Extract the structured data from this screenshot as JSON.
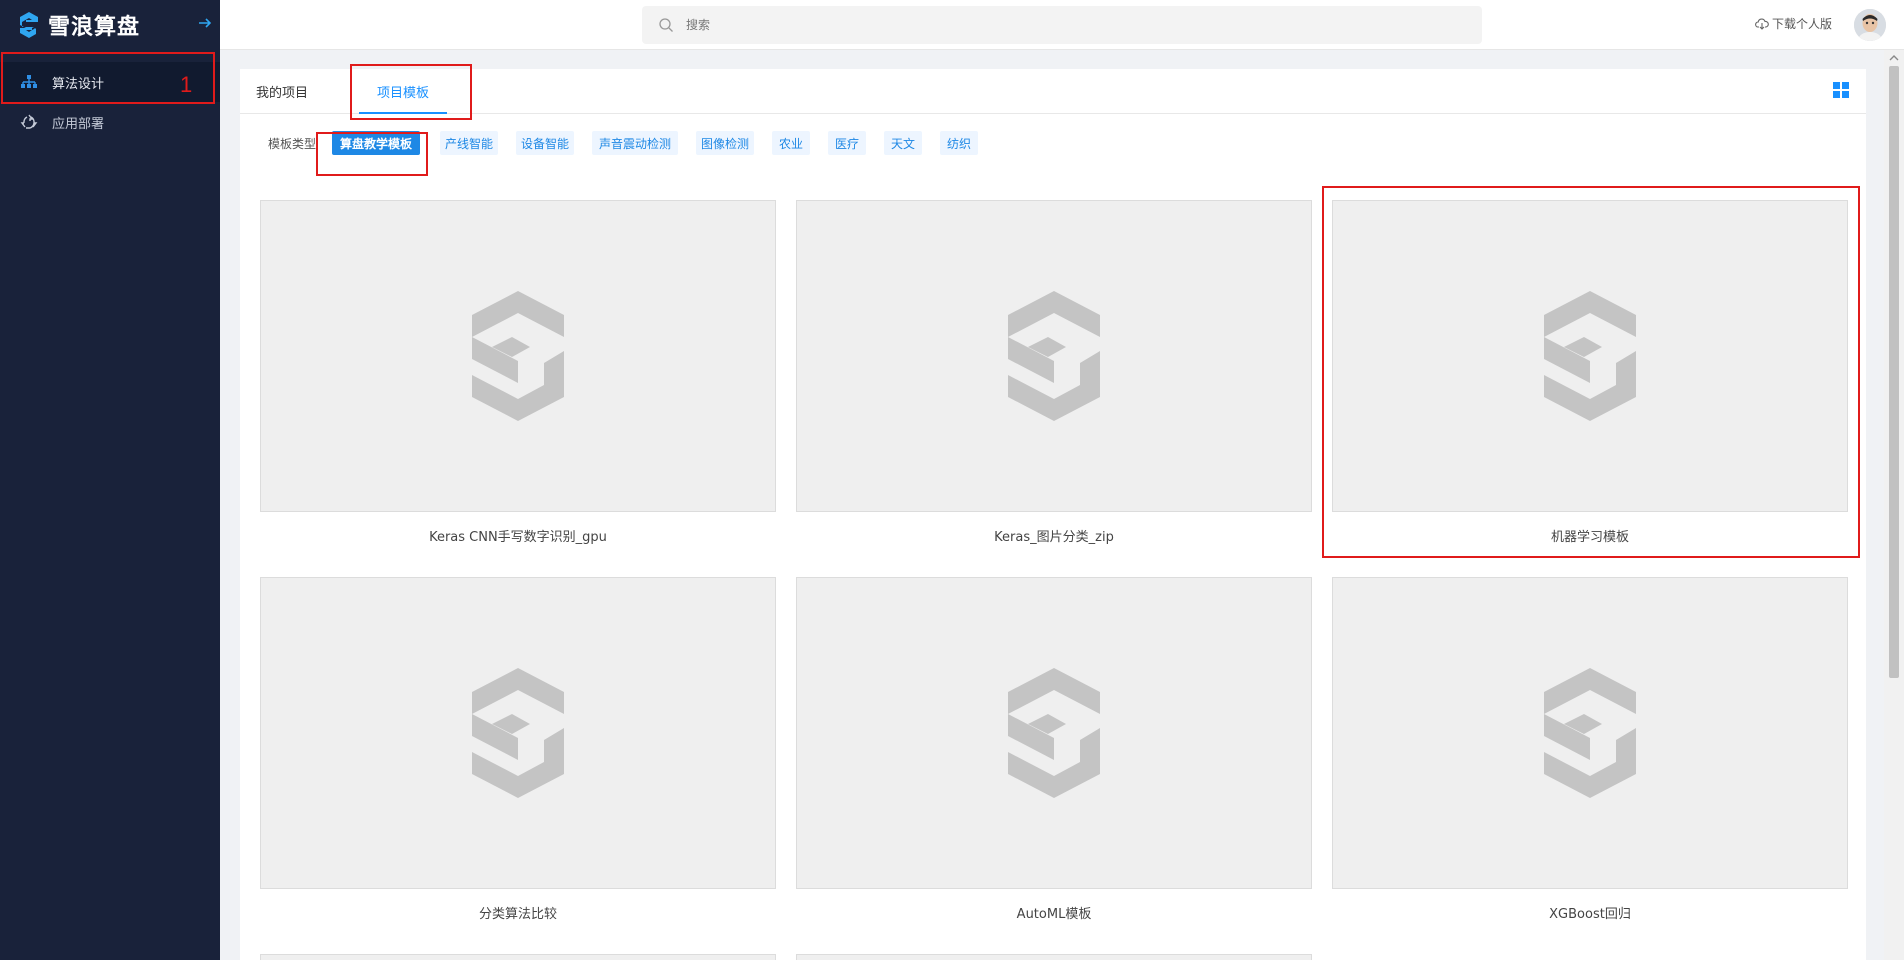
{
  "brand": {
    "name": "雪浪算盘"
  },
  "sidebar": {
    "items": [
      {
        "label": "算法设计",
        "icon": "org-tree-icon",
        "active": true
      },
      {
        "label": "应用部署",
        "icon": "recycle-icon",
        "active": false
      }
    ],
    "annotation_number": "1"
  },
  "header": {
    "search_placeholder": "搜索",
    "download_label": "下载个人版"
  },
  "tabs": [
    {
      "label": "我的项目",
      "active": false
    },
    {
      "label": "项目模板",
      "active": true
    }
  ],
  "template_types": {
    "label": "模板类型",
    "chips": [
      {
        "label": "算盘教学模板",
        "active": true
      },
      {
        "label": "产线智能",
        "active": false
      },
      {
        "label": "设备智能",
        "active": false
      },
      {
        "label": "声音震动检测",
        "active": false
      },
      {
        "label": "图像检测",
        "active": false
      },
      {
        "label": "农业",
        "active": false
      },
      {
        "label": "医疗",
        "active": false
      },
      {
        "label": "天文",
        "active": false
      },
      {
        "label": "纺织",
        "active": false
      }
    ]
  },
  "templates": [
    {
      "title": "Keras CNN手写数字识别_gpu"
    },
    {
      "title": "Keras_图片分类_zip"
    },
    {
      "title": "机器学习模板"
    },
    {
      "title": "分类算法比较"
    },
    {
      "title": "AutoML模板"
    },
    {
      "title": "XGBoost回归"
    }
  ],
  "colors": {
    "sidebar_bg": "#19223a",
    "accent": "#1890ff",
    "annotation_red": "#e01b1b",
    "placeholder_logo": "#c4c4c4"
  }
}
